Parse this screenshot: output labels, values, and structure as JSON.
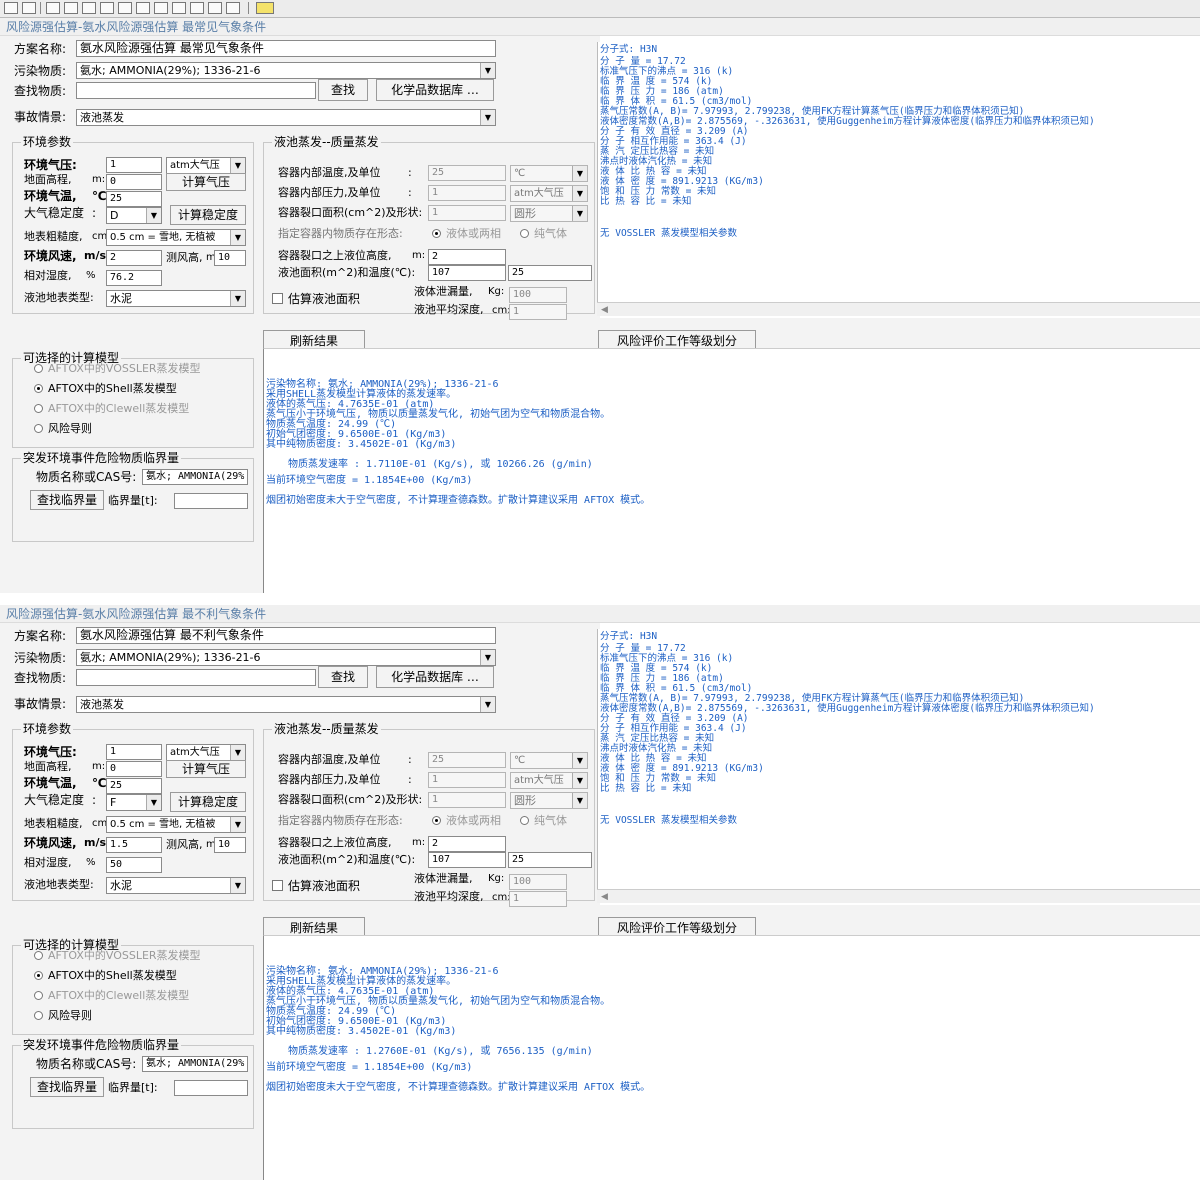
{
  "panels": [
    {
      "title": "风险源强估算-氨水风险源强估算  最常见气象条件",
      "scheme_label": "方案名称:",
      "scheme_value": "氨水风险源强估算  最常见气象条件",
      "pollutant_label": "污染物质:",
      "pollutant_value": "氨水; AMMONIA(29%); 1336-21-6",
      "lookup_label": "查找物质:",
      "lookup_value": "",
      "find_button": "查找",
      "chem_db_button": "化学品数据库 …",
      "accident_label": "事故情景:",
      "accident_value": "液池蒸发",
      "env": {
        "group_title": "环境参数",
        "pressure_label": "环境气压:",
        "pressure_value": "1",
        "pressure_unit": "atm大气压",
        "calc_pressure_button": "计算气压",
        "elevation_label": "地面高程,",
        "elevation_unit": "m:",
        "elevation_value": "0",
        "temp_label": "环境气温,",
        "temp_unit": "℃",
        "temp_value": "25",
        "stability_label": "大气稳定度",
        "stability_colon": ":",
        "stability_value": "D",
        "calc_stability_button": "计算稳定度",
        "roughness_label": "地表粗糙度,",
        "roughness_unit": "cm",
        "roughness_value": "0.5 cm = 雪地, 无植被",
        "wind_label": "环境风速,",
        "wind_unit": "m/s",
        "wind_value": "2",
        "wind_height_label": "测风高,",
        "wind_height_unit": "m",
        "wind_height_value": "10",
        "humidity_label": "相对湿度,",
        "humidity_unit": "%",
        "humidity_value": "76.2",
        "ground_label": "液池地表类型:",
        "ground_value": "水泥"
      },
      "evap": {
        "group_title": "液池蒸发--质量蒸发",
        "temp_label": "容器内部温度,及单位",
        "temp_colon": ":",
        "temp_value": "25",
        "temp_unit": "℃",
        "press_label": "容器内部压力,及单位",
        "press_colon": ":",
        "press_value": "1",
        "press_unit": "atm大气压",
        "area_label": "容器裂口面积(cm^2)及形状:",
        "area_value": "1",
        "area_shape": "圆形",
        "state_label": "指定容器内物质存在形态:",
        "state_opt1": "液体或两相",
        "state_opt2": "纯气体",
        "height_label": "容器裂口之上液位高度,",
        "height_unit": "m:",
        "height_value": "2",
        "pool_label": "液池面积(m^2)和温度(℃):",
        "pool_area": "107",
        "pool_temp": "25",
        "estimate_label": "估算液池面积",
        "leak_label": "液体泄漏量,",
        "leak_unit": "Kg:",
        "leak_value": "100",
        "depth_label": "液池平均深度,",
        "depth_unit": "cm:",
        "depth_value": "1"
      },
      "info_lines": [
        "分子式: H3N",
        "分  子  量      = 17.72",
        "标准气压下的沸点 = 316 (k)",
        "临  界  温  度   = 574 (k)",
        "临  界  压  力   = 186 (atm)",
        "临  界  体  积   = 61.5 (cm3/mol)",
        "蒸气压常数(A, B)= 7.97993, 2.799238, 使用FK方程计算蒸气压(临界压力和临界体积须已知)",
        "液体密度常数(A,B)= 2.875569, -.3263631, 使用Guggenheim方程计算液体密度(临界压力和临界体积须已知)",
        "分  子  有  效  直径 = 3.209 (A)",
        "分  子  相互作用能 = 363.4 (J)",
        "蒸  汽  定压比热容 = 未知",
        "沸点时液体汽化热 = 未知",
        "液  体  比  热  容 = 未知",
        "液  体  密  度   = 891.9213 (KG/m3)",
        "饱  和  压  力  常数 = 未知",
        "比  热  容  比   = 未知",
        "",
        "无 VOSSLER 蒸发模型相关参数"
      ],
      "refresh_button": "刷新结果",
      "grade_button": "风险评价工作等级划分",
      "models": {
        "group_title": "可选择的计算模型",
        "opt1": "AFTOX中的VOSSLER蒸发模型",
        "opt2": "AFTOX中的Shell蒸发模型",
        "opt3": "AFTOX中的Clewell蒸发模型",
        "opt4": "风险导则"
      },
      "threshold": {
        "group_title": "突发环境事件危险物质临界量",
        "name_label": "物质名称或CAS号:",
        "name_value": "氨水; AMMONIA(29%",
        "find_button": "查找临界量",
        "qty_label": "临界量[t]:",
        "qty_value": ""
      },
      "results": [
        "污染物名称: 氨水; AMMONIA(29%); 1336-21-6",
        "    采用SHELL蒸发模型计算液体的蒸发速率。",
        "    液体的蒸气压: 4.7635E-01 (atm)",
        "    蒸气压小于环境气压, 物质以质量蒸发气化, 初始气团为空气和物质混合物。",
        "    物质蒸气温度: 24.99 (℃)",
        "    初始气团密度: 9.6500E-01 (Kg/m3)",
        "        其中纯物质密度: 3.4502E-01 (Kg/m3)",
        "    物质蒸发速率 : 1.7110E-01 (Kg/s), 或 10266.26 (g/min)",
        "当前环境空气密度 = 1.1854E+00 (Kg/m3)",
        "烟团初始密度未大于空气密度, 不计算理查德森数。扩散计算建议采用 AFTOX 模式。"
      ]
    },
    {
      "title": "风险源强估算-氨水风险源强估算  最不利气象条件",
      "scheme_label": "方案名称:",
      "scheme_value": "氨水风险源强估算  最不利气象条件",
      "pollutant_label": "污染物质:",
      "pollutant_value": "氨水; AMMONIA(29%); 1336-21-6",
      "lookup_label": "查找物质:",
      "lookup_value": "",
      "find_button": "查找",
      "chem_db_button": "化学品数据库 …",
      "accident_label": "事故情景:",
      "accident_value": "液池蒸发",
      "env": {
        "group_title": "环境参数",
        "pressure_label": "环境气压:",
        "pressure_value": "1",
        "pressure_unit": "atm大气压",
        "calc_pressure_button": "计算气压",
        "elevation_label": "地面高程,",
        "elevation_unit": "m:",
        "elevation_value": "0",
        "temp_label": "环境气温,",
        "temp_unit": "℃",
        "temp_value": "25",
        "stability_label": "大气稳定度",
        "stability_colon": ":",
        "stability_value": "F",
        "calc_stability_button": "计算稳定度",
        "roughness_label": "地表粗糙度,",
        "roughness_unit": "cm",
        "roughness_value": "0.5 cm = 雪地, 无植被",
        "wind_label": "环境风速,",
        "wind_unit": "m/s",
        "wind_value": "1.5",
        "wind_height_label": "测风高,",
        "wind_height_unit": "m",
        "wind_height_value": "10",
        "humidity_label": "相对湿度,",
        "humidity_unit": "%",
        "humidity_value": "50",
        "ground_label": "液池地表类型:",
        "ground_value": "水泥"
      },
      "evap": {
        "group_title": "液池蒸发--质量蒸发",
        "temp_label": "容器内部温度,及单位",
        "temp_colon": ":",
        "temp_value": "25",
        "temp_unit": "℃",
        "press_label": "容器内部压力,及单位",
        "press_colon": ":",
        "press_value": "1",
        "press_unit": "atm大气压",
        "area_label": "容器裂口面积(cm^2)及形状:",
        "area_value": "1",
        "area_shape": "圆形",
        "state_label": "指定容器内物质存在形态:",
        "state_opt1": "液体或两相",
        "state_opt2": "纯气体",
        "height_label": "容器裂口之上液位高度,",
        "height_unit": "m:",
        "height_value": "2",
        "pool_label": "液池面积(m^2)和温度(℃):",
        "pool_area": "107",
        "pool_temp": "25",
        "estimate_label": "估算液池面积",
        "leak_label": "液体泄漏量,",
        "leak_unit": "Kg:",
        "leak_value": "100",
        "depth_label": "液池平均深度,",
        "depth_unit": "cm:",
        "depth_value": "1"
      },
      "info_lines": [
        "分子式: H3N",
        "分  子  量      = 17.72",
        "标准气压下的沸点 = 316 (k)",
        "临  界  温  度   = 574 (k)",
        "临  界  压  力   = 186 (atm)",
        "临  界  体  积   = 61.5 (cm3/mol)",
        "蒸气压常数(A, B)= 7.97993, 2.799238, 使用FK方程计算蒸气压(临界压力和临界体积须已知)",
        "液体密度常数(A,B)= 2.875569, -.3263631, 使用Guggenheim方程计算液体密度(临界压力和临界体积须已知)",
        "分  子  有  效  直径 = 3.209 (A)",
        "分  子  相互作用能 = 363.4 (J)",
        "蒸  汽  定压比热容 = 未知",
        "沸点时液体汽化热 = 未知",
        "液  体  比  热  容 = 未知",
        "液  体  密  度   = 891.9213 (KG/m3)",
        "饱  和  压  力  常数 = 未知",
        "比  热  容  比   = 未知",
        "",
        "无 VOSSLER 蒸发模型相关参数"
      ],
      "refresh_button": "刷新结果",
      "grade_button": "风险评价工作等级划分",
      "models": {
        "group_title": "可选择的计算模型",
        "opt1": "AFTOX中的VOSSLER蒸发模型",
        "opt2": "AFTOX中的Shell蒸发模型",
        "opt3": "AFTOX中的Clewell蒸发模型",
        "opt4": "风险导则"
      },
      "threshold": {
        "group_title": "突发环境事件危险物质临界量",
        "name_label": "物质名称或CAS号:",
        "name_value": "氨水; AMMONIA(29%",
        "find_button": "查找临界量",
        "qty_label": "临界量[t]:",
        "qty_value": ""
      },
      "results": [
        "污染物名称: 氨水; AMMONIA(29%); 1336-21-6",
        "    采用SHELL蒸发模型计算液体的蒸发速率。",
        "    液体的蒸气压: 4.7635E-01 (atm)",
        "    蒸气压小于环境气压, 物质以质量蒸发气化, 初始气团为空气和物质混合物。",
        "    物质蒸气温度: 24.99 (℃)",
        "    初始气团密度: 9.6500E-01 (Kg/m3)",
        "        其中纯物质密度: 3.4502E-01 (Kg/m3)",
        "    物质蒸发速率 : 1.2760E-01 (Kg/s), 或 7656.135 (g/min)",
        "当前环境空气密度 = 1.1854E+00 (Kg/m3)",
        "烟团初始密度未大于空气密度, 不计算理查德森数。扩散计算建议采用 AFTOX 模式。"
      ]
    }
  ],
  "colors": {
    "info_text": "#1c5fc4",
    "title_text": "#5a7fa8",
    "panel_bg": "#f3f3f3"
  }
}
